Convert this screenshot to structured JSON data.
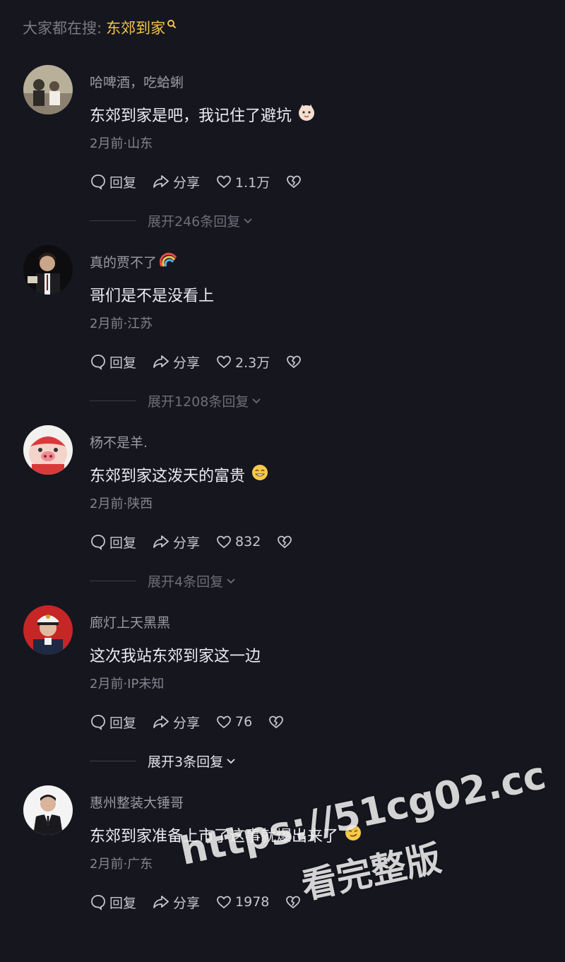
{
  "search": {
    "prefix": "大家都在搜:",
    "keyword": "东郊到家"
  },
  "comments": [
    {
      "username": "哈啤酒，吃蛤蜊",
      "text": "东郊到家是吧，我记住了避坑",
      "emoji": "cat-face-emoji",
      "meta": "2月前·山东",
      "reply_label": "回复",
      "share_label": "分享",
      "likes": "1.1万",
      "expand": "展开246条回复"
    },
    {
      "username": "真的贾不了",
      "text": "哥们是不是没看上",
      "emoji": "rainbow-emoji",
      "meta": "2月前·江苏",
      "reply_label": "回复",
      "share_label": "分享",
      "likes": "2.3万",
      "expand": "展开1208条回复"
    },
    {
      "username": "杨不是羊.",
      "text": "东郊到家这泼天的富贵",
      "emoji": "grin-emoji",
      "meta": "2月前·陕西",
      "reply_label": "回复",
      "share_label": "分享",
      "likes": "832",
      "expand": "展开4条回复"
    },
    {
      "username": "廊灯上天黑黑",
      "text": "这次我站东郊到家这一边",
      "meta": "2月前·IP未知",
      "reply_label": "回复",
      "share_label": "分享",
      "likes": "76",
      "expand": "展开3条回复"
    },
    {
      "username": "惠州整装大锤哥",
      "text": "东郊到家准备上市了这事就爆出来了",
      "emoji": "smirk-emoji",
      "meta": "2月前·广东",
      "reply_label": "回复",
      "share_label": "分享",
      "likes": "1978"
    }
  ],
  "watermark": {
    "line1": "https://51cg02.cc",
    "line2": "看完整版"
  },
  "colors": {
    "background": "#16161f",
    "keyword": "#f2c64a",
    "muted": "#858592"
  }
}
